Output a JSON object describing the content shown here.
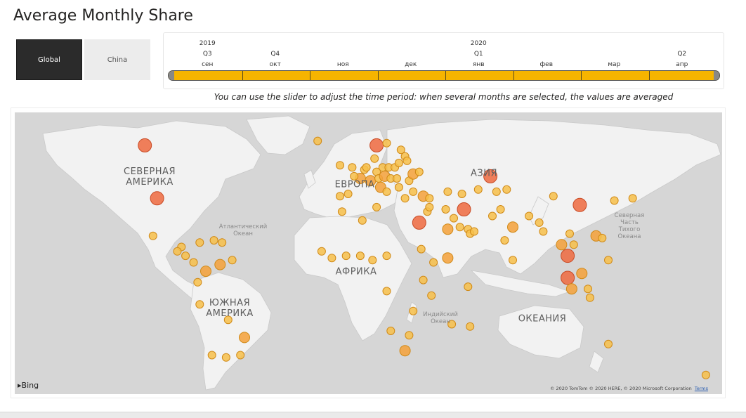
{
  "page": {
    "title": "Average Monthly Share"
  },
  "buttons": {
    "global": "Global",
    "china": "China"
  },
  "timeline": {
    "years": [
      {
        "label": "2019",
        "col": 0
      },
      {
        "label": "2020",
        "col": 4
      }
    ],
    "quarters": [
      {
        "label": "Q3",
        "col": 0
      },
      {
        "label": "Q4",
        "col": 1
      },
      {
        "label": "Q1",
        "col": 4
      },
      {
        "label": "Q2",
        "col": 7
      }
    ],
    "months": [
      "сен",
      "окт",
      "ноя",
      "дек",
      "янв",
      "фев",
      "мар",
      "апр"
    ],
    "selected_range": [
      "сен",
      "апр"
    ],
    "fill_color": "#f6b400"
  },
  "hint": "You can use the slider to adjust the time period: when several months are selected, the values are averaged",
  "map": {
    "regions": {
      "north_america": "СЕВЕРНАЯ\nАМЕРИКА",
      "south_america": "ЮЖНАЯ\nАМЕРИКА",
      "europe": "ЕВРОПА",
      "africa": "АФРИКА",
      "asia": "АЗИЯ",
      "oceania": "ОКЕАНИЯ"
    },
    "oceans": {
      "atlantic": "Атлантический\nОкеан",
      "indian": "Индийский\nОкеан",
      "pacific": "Северная\nЧасть\nТихого\nОкеана"
    },
    "bubble_colors": {
      "low": "#f7c04a",
      "mid": "#f4a13a",
      "high": "#ee6a3f"
    },
    "bubbles": [
      {
        "lon": -104,
        "lat": 62,
        "level": "high"
      },
      {
        "lon": -98,
        "lat": 38,
        "level": "high"
      },
      {
        "lon": -100,
        "lat": 21,
        "level": "low"
      },
      {
        "lon": -86,
        "lat": 16,
        "level": "low"
      },
      {
        "lon": -88,
        "lat": 14,
        "level": "low"
      },
      {
        "lon": -84,
        "lat": 12,
        "level": "low"
      },
      {
        "lon": -80,
        "lat": 9,
        "level": "low"
      },
      {
        "lon": -77,
        "lat": 18,
        "level": "low"
      },
      {
        "lon": -70,
        "lat": 19,
        "level": "low"
      },
      {
        "lon": -66,
        "lat": 18,
        "level": "low"
      },
      {
        "lon": -74,
        "lat": 5,
        "level": "mid"
      },
      {
        "lon": -67,
        "lat": 8,
        "level": "mid"
      },
      {
        "lon": -61,
        "lat": 10,
        "level": "low"
      },
      {
        "lon": -78,
        "lat": 0,
        "level": "low"
      },
      {
        "lon": -77,
        "lat": -10,
        "level": "low"
      },
      {
        "lon": -63,
        "lat": -17,
        "level": "low"
      },
      {
        "lon": -55,
        "lat": -25,
        "level": "mid"
      },
      {
        "lon": -57,
        "lat": -33,
        "level": "low"
      },
      {
        "lon": -64,
        "lat": -34,
        "level": "low"
      },
      {
        "lon": -71,
        "lat": -33,
        "level": "low"
      },
      {
        "lon": -19,
        "lat": 64,
        "level": "low"
      },
      {
        "lon": 10,
        "lat": 62,
        "level": "high"
      },
      {
        "lon": 15,
        "lat": 63,
        "level": "low"
      },
      {
        "lon": 22,
        "lat": 60,
        "level": "low"
      },
      {
        "lon": 24,
        "lat": 57,
        "level": "low"
      },
      {
        "lon": 25,
        "lat": 55,
        "level": "low"
      },
      {
        "lon": -8,
        "lat": 53,
        "level": "low"
      },
      {
        "lon": -2,
        "lat": 52,
        "level": "low"
      },
      {
        "lon": 4,
        "lat": 51,
        "level": "low"
      },
      {
        "lon": 5,
        "lat": 52,
        "level": "low"
      },
      {
        "lon": 9,
        "lat": 56,
        "level": "low"
      },
      {
        "lon": 13,
        "lat": 52,
        "level": "low"
      },
      {
        "lon": 10,
        "lat": 50,
        "level": "low"
      },
      {
        "lon": 16,
        "lat": 52,
        "level": "low"
      },
      {
        "lon": 19,
        "lat": 52,
        "level": "low"
      },
      {
        "lon": 21,
        "lat": 54,
        "level": "low"
      },
      {
        "lon": 2,
        "lat": 47,
        "level": "mid"
      },
      {
        "lon": -1,
        "lat": 48,
        "level": "low"
      },
      {
        "lon": 7,
        "lat": 46,
        "level": "mid"
      },
      {
        "lon": 11,
        "lat": 47,
        "level": "low"
      },
      {
        "lon": 14,
        "lat": 48,
        "level": "mid"
      },
      {
        "lon": 17,
        "lat": 47,
        "level": "low"
      },
      {
        "lon": 20,
        "lat": 47,
        "level": "low"
      },
      {
        "lon": 26,
        "lat": 46,
        "level": "low"
      },
      {
        "lon": 28,
        "lat": 49,
        "level": "mid"
      },
      {
        "lon": 31,
        "lat": 50,
        "level": "low"
      },
      {
        "lon": 12,
        "lat": 43,
        "level": "mid"
      },
      {
        "lon": 15,
        "lat": 41,
        "level": "low"
      },
      {
        "lon": 21,
        "lat": 43,
        "level": "low"
      },
      {
        "lon": -4,
        "lat": 40,
        "level": "low"
      },
      {
        "lon": -8,
        "lat": 39,
        "level": "low"
      },
      {
        "lon": 24,
        "lat": 38,
        "level": "low"
      },
      {
        "lon": 28,
        "lat": 41,
        "level": "low"
      },
      {
        "lon": 33,
        "lat": 39,
        "level": "mid"
      },
      {
        "lon": 36,
        "lat": 38,
        "level": "low"
      },
      {
        "lon": 45,
        "lat": 41,
        "level": "low"
      },
      {
        "lon": 52,
        "lat": 40,
        "level": "low"
      },
      {
        "lon": 66,
        "lat": 48,
        "level": "high"
      },
      {
        "lon": 69,
        "lat": 41,
        "level": "low"
      },
      {
        "lon": 60,
        "lat": 42,
        "level": "low"
      },
      {
        "lon": 74,
        "lat": 42,
        "level": "low"
      },
      {
        "lon": 35,
        "lat": 32,
        "level": "low"
      },
      {
        "lon": 36,
        "lat": 34,
        "level": "low"
      },
      {
        "lon": 44,
        "lat": 33,
        "level": "low"
      },
      {
        "lon": 53,
        "lat": 33,
        "level": "high"
      },
      {
        "lon": 48,
        "lat": 29,
        "level": "low"
      },
      {
        "lon": 51,
        "lat": 25,
        "level": "low"
      },
      {
        "lon": 55,
        "lat": 24,
        "level": "low"
      },
      {
        "lon": 56,
        "lat": 22,
        "level": "low"
      },
      {
        "lon": 58,
        "lat": 23,
        "level": "low"
      },
      {
        "lon": 45,
        "lat": 24,
        "level": "mid"
      },
      {
        "lon": 31,
        "lat": 27,
        "level": "high"
      },
      {
        "lon": 10,
        "lat": 34,
        "level": "low"
      },
      {
        "lon": 3,
        "lat": 28,
        "level": "low"
      },
      {
        "lon": -7,
        "lat": 32,
        "level": "low"
      },
      {
        "lon": -17,
        "lat": 14,
        "level": "low"
      },
      {
        "lon": -12,
        "lat": 11,
        "level": "low"
      },
      {
        "lon": -5,
        "lat": 12,
        "level": "low"
      },
      {
        "lon": 2,
        "lat": 12,
        "level": "low"
      },
      {
        "lon": 8,
        "lat": 10,
        "level": "low"
      },
      {
        "lon": 15,
        "lat": 12,
        "level": "low"
      },
      {
        "lon": 32,
        "lat": 15,
        "level": "low"
      },
      {
        "lon": 38,
        "lat": 9,
        "level": "low"
      },
      {
        "lon": 45,
        "lat": 11,
        "level": "mid"
      },
      {
        "lon": 33,
        "lat": 1,
        "level": "low"
      },
      {
        "lon": 37,
        "lat": -6,
        "level": "low"
      },
      {
        "lon": 15,
        "lat": -4,
        "level": "low"
      },
      {
        "lon": 28,
        "lat": -13,
        "level": "low"
      },
      {
        "lon": 17,
        "lat": -22,
        "level": "low"
      },
      {
        "lon": 26,
        "lat": -24,
        "level": "low"
      },
      {
        "lon": 24,
        "lat": -31,
        "level": "mid"
      },
      {
        "lon": 47,
        "lat": -19,
        "level": "low"
      },
      {
        "lon": 55,
        "lat": -2,
        "level": "low"
      },
      {
        "lon": 56,
        "lat": -20,
        "level": "low"
      },
      {
        "lon": 67,
        "lat": 30,
        "level": "low"
      },
      {
        "lon": 71,
        "lat": 33,
        "level": "low"
      },
      {
        "lon": 77,
        "lat": 25,
        "level": "mid"
      },
      {
        "lon": 73,
        "lat": 19,
        "level": "low"
      },
      {
        "lon": 77,
        "lat": 10,
        "level": "low"
      },
      {
        "lon": 85,
        "lat": 30,
        "level": "low"
      },
      {
        "lon": 90,
        "lat": 27,
        "level": "low"
      },
      {
        "lon": 92,
        "lat": 23,
        "level": "low"
      },
      {
        "lon": 97,
        "lat": 39,
        "level": "low"
      },
      {
        "lon": 110,
        "lat": 35,
        "level": "high"
      },
      {
        "lon": 105,
        "lat": 22,
        "level": "low"
      },
      {
        "lon": 101,
        "lat": 17,
        "level": "mid"
      },
      {
        "lon": 104,
        "lat": 12,
        "level": "high"
      },
      {
        "lon": 107,
        "lat": 17,
        "level": "low"
      },
      {
        "lon": 104,
        "lat": 2,
        "level": "high"
      },
      {
        "lon": 106,
        "lat": -3,
        "level": "mid"
      },
      {
        "lon": 111,
        "lat": 4,
        "level": "mid"
      },
      {
        "lon": 114,
        "lat": -3,
        "level": "low"
      },
      {
        "lon": 115,
        "lat": -7,
        "level": "low"
      },
      {
        "lon": 118,
        "lat": 21,
        "level": "mid"
      },
      {
        "lon": 121,
        "lat": 20,
        "level": "low"
      },
      {
        "lon": 124,
        "lat": 10,
        "level": "low"
      },
      {
        "lon": 127,
        "lat": 37,
        "level": "low"
      },
      {
        "lon": 136,
        "lat": 38,
        "level": "low"
      },
      {
        "lon": 124,
        "lat": -28,
        "level": "low"
      },
      {
        "lon": 172,
        "lat": -42,
        "level": "low"
      }
    ],
    "attribution": "© 2020 TomTom © 2020 HERE, © 2020 Microsoft Corporation",
    "terms": "Terms",
    "bing": "Bing"
  }
}
